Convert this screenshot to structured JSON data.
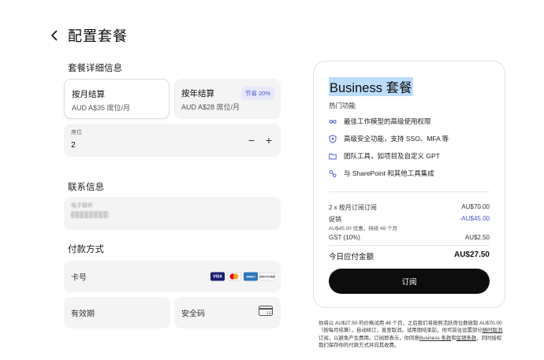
{
  "header": {
    "title": "配置套餐",
    "back_icon": "chevron-left-icon"
  },
  "plan_details": {
    "section_title": "套餐详细信息",
    "monthly": {
      "title": "按月结算",
      "price": "AUD A$35 席位/月",
      "selected": true
    },
    "yearly": {
      "title": "按年结算",
      "price": "AUD A$28 席位/月",
      "badge": "节省 20%",
      "selected": false
    },
    "seats": {
      "label": "席位",
      "value": "2",
      "minus": "−",
      "plus": "+"
    }
  },
  "contact": {
    "section_title": "联系信息",
    "email_label": "电子邮件"
  },
  "payment": {
    "section_title": "付款方式",
    "card_number_placeholder": "卡号",
    "card_brands": [
      "VISA",
      "mastercard",
      "AMEX",
      "DISCOVER"
    ],
    "expiry_placeholder": "有效期",
    "cvc_placeholder": "安全码",
    "cvc_icon": "card-cvc-icon",
    "cvc_digits": "123"
  },
  "summary": {
    "plan_name": "Business 套餐",
    "features_title": "热门功能",
    "features": [
      {
        "icon": "infinity-icon",
        "text": "最佳工作模型的高级使用权限"
      },
      {
        "icon": "shield-lock-icon",
        "text": "高级安全功能，支持 SSO、MFA 等"
      },
      {
        "icon": "folder-icon",
        "text": "团队工具，如项目及自定义 GPT"
      },
      {
        "icon": "integration-icon",
        "text": "与 SharePoint 和其他工具集成"
      }
    ],
    "line_item": {
      "label": "2 x 按月订阅订阅",
      "amount": "AU$70.00"
    },
    "promo": {
      "label": "促销",
      "amount": "-AU$45.00",
      "detail": "AU$45.00 优惠，持续 48 个月"
    },
    "gst": {
      "label": "GST (10%)",
      "amount": "AU$2.50"
    },
    "total": {
      "label": "今日应付金额",
      "amount": "AU$27.50"
    },
    "subscribe_label": "订阅",
    "accent_color": "#4a55c9"
  },
  "legal": {
    "part1": "你将以 AU$27.50 的价格试用 48 个月，之后我们将按照活跃席位数收取 AU$70.00（按每月结算），自动续订，直至取消。试用期结束前，你可前往设置部分",
    "link1": "随时取消",
    "part2": "订阅，以避免产生费用。订阅即表示，你同意",
    "link2": "Business 条款",
    "part3": "和",
    "link3": "促销条款",
    "part4": "，同时授权我们保存你的付款方式并向其收费。"
  }
}
